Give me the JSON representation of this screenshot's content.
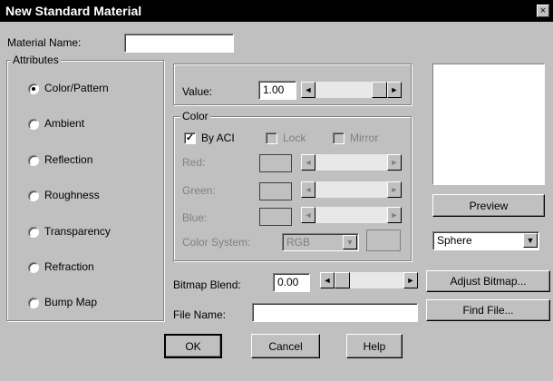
{
  "window": {
    "title": "New Standard Material",
    "close_glyph": "×"
  },
  "material_name": {
    "label": "Material Name:",
    "value": ""
  },
  "attributes": {
    "title": "Attributes",
    "items": [
      {
        "label": "Color/Pattern",
        "selected": true
      },
      {
        "label": "Ambient",
        "selected": false
      },
      {
        "label": "Reflection",
        "selected": false
      },
      {
        "label": "Roughness",
        "selected": false
      },
      {
        "label": "Transparency",
        "selected": false
      },
      {
        "label": "Refraction",
        "selected": false
      },
      {
        "label": "Bump Map",
        "selected": false
      }
    ]
  },
  "value": {
    "label": "Value:",
    "value": "1.00",
    "slider_level": 1.0
  },
  "color": {
    "title": "Color",
    "by_aci": {
      "label": "By ACI",
      "checked": true
    },
    "lock": {
      "label": "Lock",
      "checked": false
    },
    "mirror": {
      "label": "Mirror",
      "checked": false
    },
    "red_label": "Red:",
    "green_label": "Green:",
    "blue_label": "Blue:",
    "color_system_label": "Color System:",
    "color_system_value": "RGB"
  },
  "preview": {
    "button": "Preview",
    "shape": "Sphere"
  },
  "bitmap": {
    "blend_label": "Bitmap Blend:",
    "blend_value": "0.00",
    "blend_level": 0.0,
    "adjust_button": "Adjust Bitmap...",
    "file_label": "File Name:",
    "file_value": "",
    "find_button": "Find File..."
  },
  "actions": {
    "ok": "OK",
    "cancel": "Cancel",
    "help": "Help"
  },
  "icons": {
    "arrow_left": "◄",
    "arrow_right": "►",
    "arrow_down": "▼",
    "check": "✓"
  },
  "colors": {
    "title_bar": "#000000",
    "dialog_bg": "#c0c0c0",
    "disabled_text": "#808080"
  }
}
